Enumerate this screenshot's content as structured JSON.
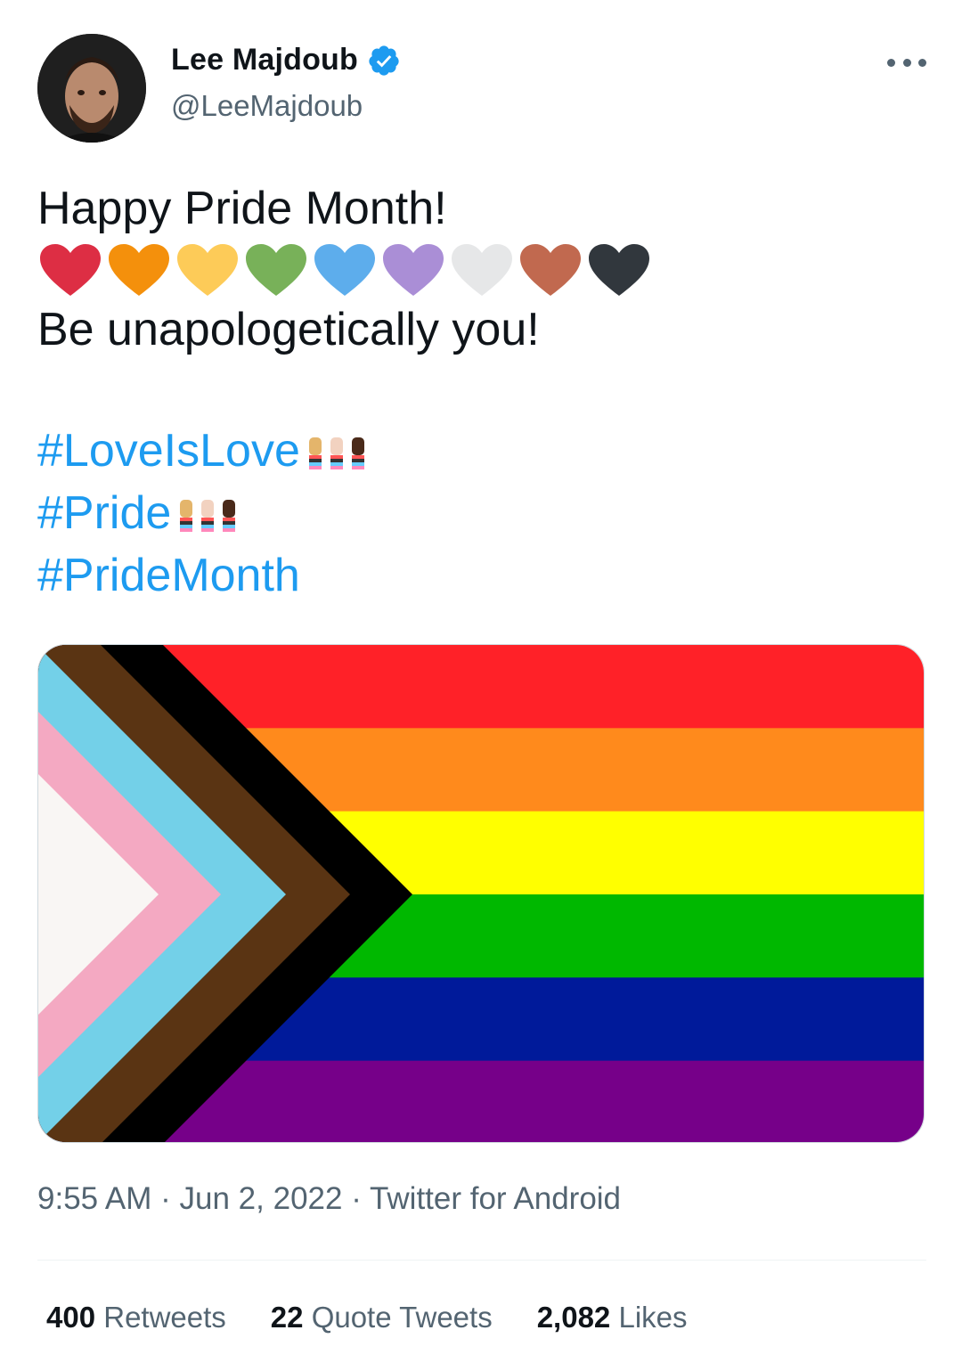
{
  "author": {
    "name": "Lee Majdoub",
    "handle": "@LeeMajdoub",
    "verified": true
  },
  "tweet": {
    "line1": "Happy Pride Month!",
    "hearts": [
      "#dd2e44",
      "#f4900c",
      "#fdcb58",
      "#78b159",
      "#5dadec",
      "#aa8ed6",
      "#e6e7e8",
      "#c1694f",
      "#31373d"
    ],
    "line2": "Be unapologetically you!",
    "hashtags": [
      "#LoveIsLove",
      "#Pride",
      "#PrideMonth"
    ]
  },
  "media": {
    "stripes": [
      "#ff2128",
      "#ff8a1c",
      "#ffff00",
      "#00b800",
      "#001a9a",
      "#760089"
    ],
    "chevrons": [
      "#f9f6f4",
      "#f4a9c2",
      "#73d0e8",
      "#5a3413",
      "#000000"
    ]
  },
  "meta": {
    "time": "9:55 AM",
    "date": "Jun 2, 2022",
    "source": "Twitter for Android",
    "sep": " · "
  },
  "stats": {
    "retweets_count": "400",
    "retweets_label": "Retweets",
    "quotes_count": "22",
    "quotes_label": "Quote Tweets",
    "likes_count": "2,082",
    "likes_label": "Likes"
  },
  "colors": {
    "link": "#1d9bf0",
    "secondary": "#536471",
    "text": "#0f1419"
  }
}
